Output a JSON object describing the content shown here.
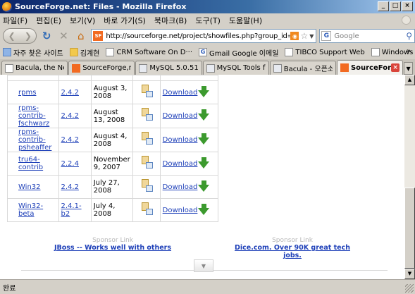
{
  "window": {
    "title": "SourceForge.net: Files - Mozilla Firefox",
    "buttons": [
      "_",
      "□",
      "×"
    ]
  },
  "menu": [
    "파일(F)",
    "편집(E)",
    "보기(V)",
    "바로 가기(S)",
    "북마크(B)",
    "도구(T)",
    "도움말(H)"
  ],
  "navbar": {
    "url": "http://sourceforge.net/project/showfiles.php?group_id=50727",
    "favicon_text": "SF",
    "search_placeholder": "Google",
    "icons": [
      "back-icon",
      "forward-icon",
      "reload-icon",
      "stop-icon",
      "home-icon"
    ]
  },
  "bookmarks": [
    {
      "label": "자주 찾은 사이트",
      "icon": "star-folder"
    },
    {
      "label": "김계현",
      "icon": "folder"
    },
    {
      "label": "CRM Software On D···",
      "icon": "page"
    },
    {
      "label": "Gmail Google 이메일",
      "icon": "google"
    },
    {
      "label": "TIBCO Support Web",
      "icon": "page"
    },
    {
      "label": "Windows Media",
      "icon": "page"
    }
  ],
  "bookmarks_more": "»",
  "tabs": [
    {
      "label": "Bacula, the Net···",
      "icon": "page",
      "active": false
    },
    {
      "label": "SourceForge,ne···",
      "icon": "sf",
      "active": false
    },
    {
      "label": "MySQL 5.0.51 ···",
      "icon": "mysql",
      "active": false
    },
    {
      "label": "MySQL Tools for···",
      "icon": "mysql",
      "active": false
    },
    {
      "label": "Bacula - 오픈소···",
      "icon": "mysql",
      "active": false
    },
    {
      "label": "SourceFor···",
      "icon": "sf",
      "active": true
    }
  ],
  "files": [
    {
      "package": "rpms",
      "version": "2.4.2",
      "date": "August 3, 2008",
      "download": "Download"
    },
    {
      "package": "rpms-contrib-fschwarz",
      "version": "2.4.2",
      "date": "August 13, 2008",
      "download": "Download"
    },
    {
      "package": "rpms-contrib-psheaffer",
      "version": "2.4.2",
      "date": "August 4, 2008",
      "download": "Download"
    },
    {
      "package": "tru64-contrib",
      "version": "2.2.4",
      "date": "November 9, 2007",
      "download": "Download"
    },
    {
      "package": "Win32",
      "version": "2.4.2",
      "date": "July 27, 2008",
      "download": "Download"
    },
    {
      "package": "Win32-beta",
      "version": "2.4.1-b2",
      "date": "July 4, 2008",
      "download": "Download"
    }
  ],
  "sponsors": [
    {
      "label": "Sponsor Link",
      "link": "JBoss -- Works well with others"
    },
    {
      "label": "Sponsor Link",
      "link": "Dice.com. Over 90K great tech jobs."
    }
  ],
  "status": "완료"
}
